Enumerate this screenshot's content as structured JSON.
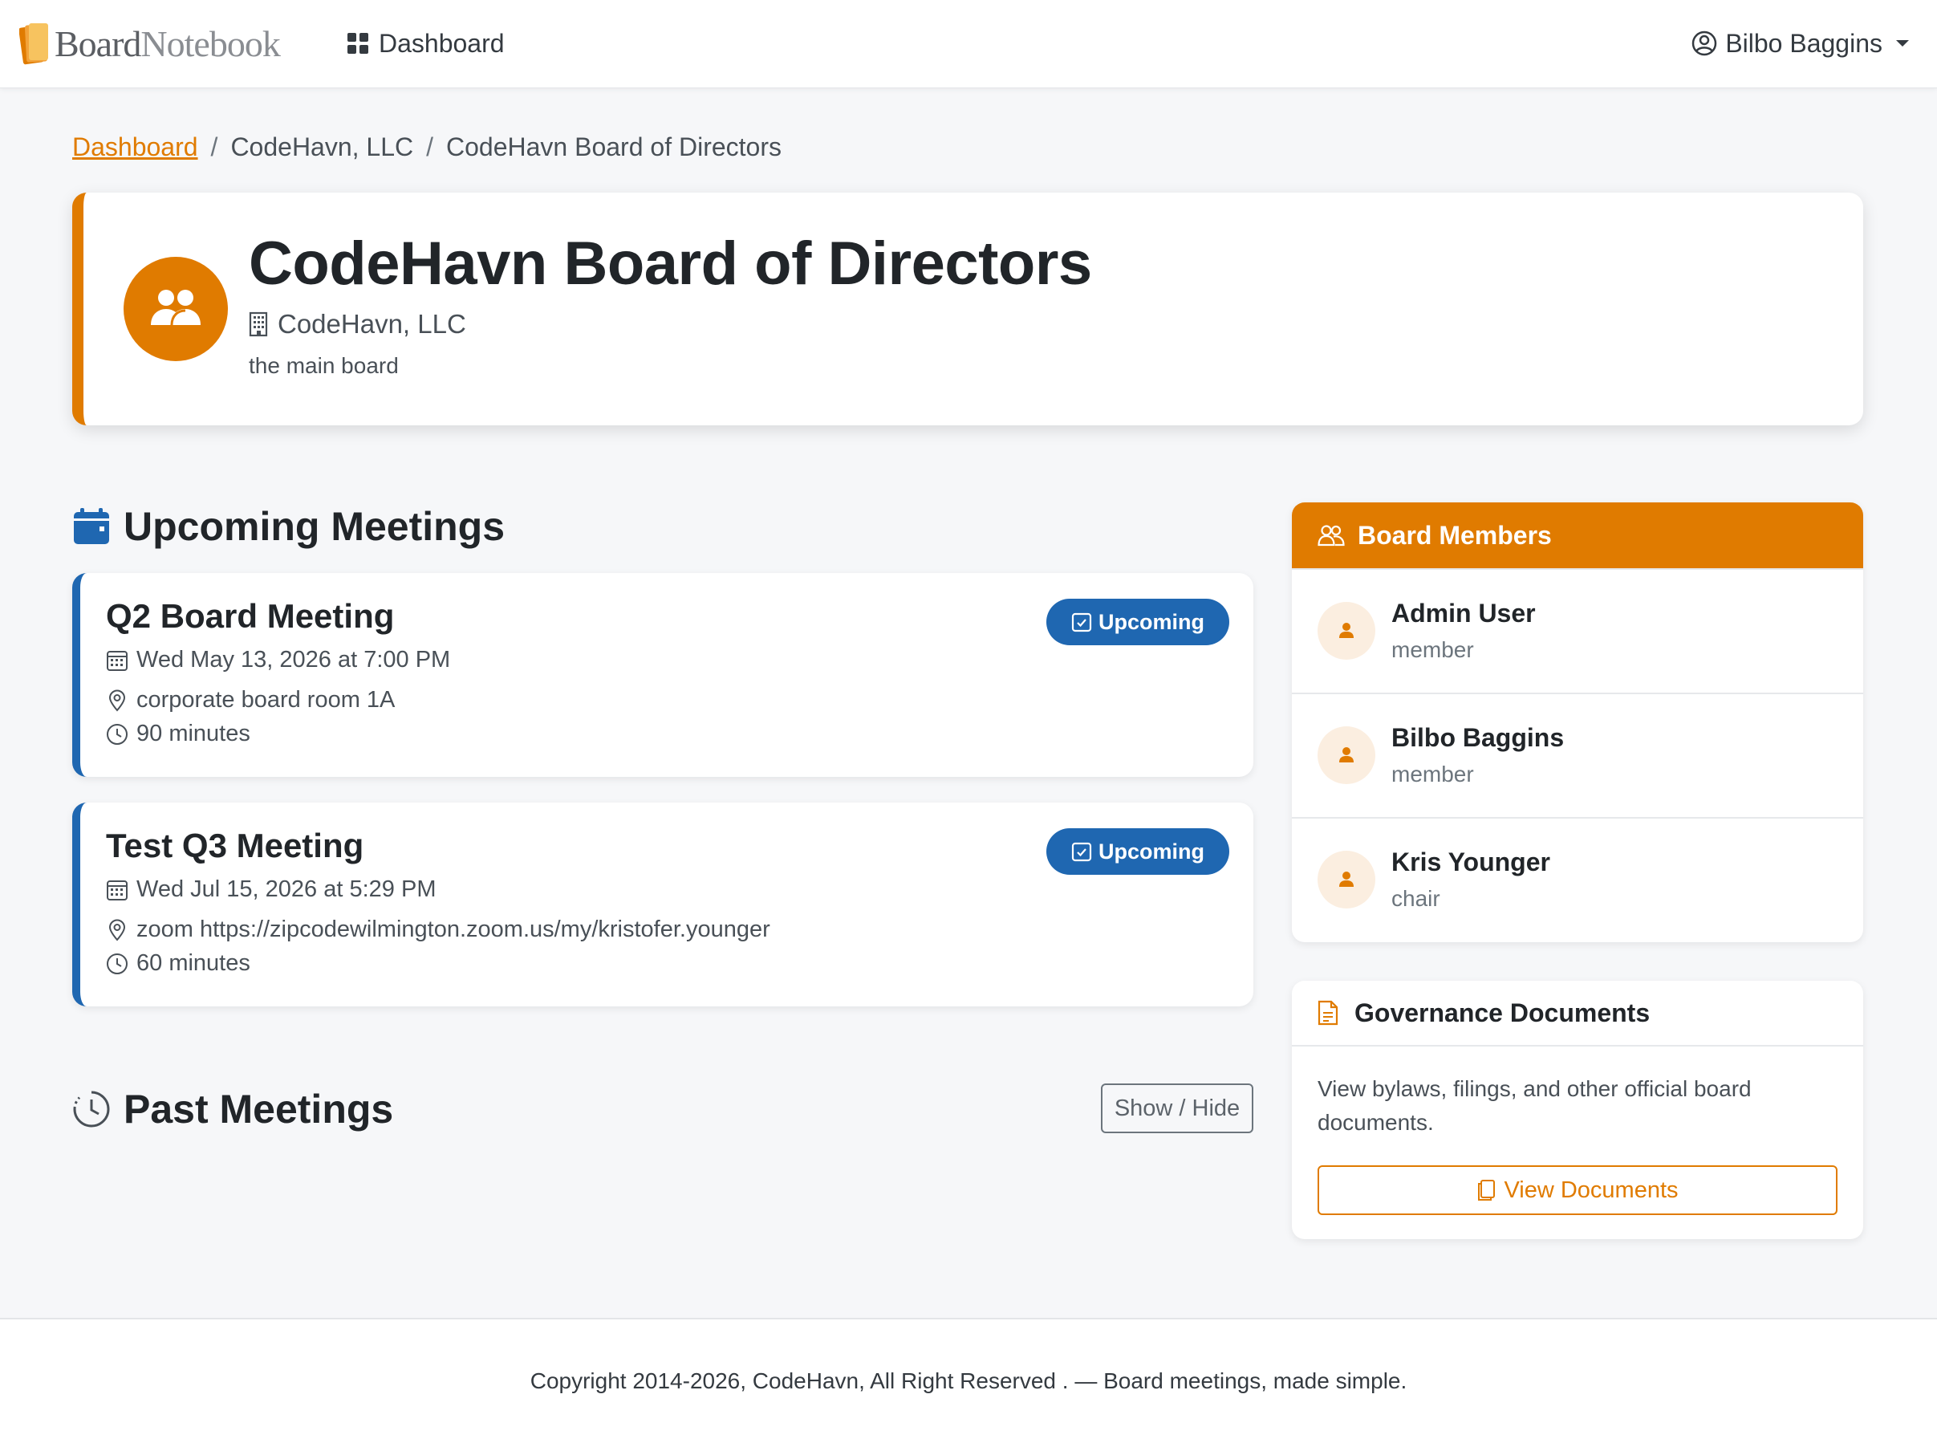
{
  "navbar": {
    "brand_part1": "Board",
    "brand_part2": "Notebook",
    "dashboard_label": "Dashboard",
    "user_name": "Bilbo Baggins"
  },
  "breadcrumb": {
    "items": [
      "Dashboard",
      "CodeHavn, LLC",
      "CodeHavn Board of Directors"
    ],
    "separator": "/"
  },
  "board": {
    "title": "CodeHavn Board of Directors",
    "organization": "CodeHavn, LLC",
    "description": "the main board"
  },
  "upcoming": {
    "heading": "Upcoming Meetings",
    "meetings": [
      {
        "title": "Q2 Board Meeting",
        "datetime": "Wed May 13, 2026 at 7:00 PM",
        "location": "corporate board room 1A",
        "duration": "90 minutes",
        "status": "Upcoming"
      },
      {
        "title": "Test Q3 Meeting",
        "datetime": "Wed Jul 15, 2026 at 5:29 PM",
        "location": "zoom https://zipcodewilmington.zoom.us/my/kristofer.younger",
        "duration": "60 minutes",
        "status": "Upcoming"
      }
    ]
  },
  "past": {
    "heading": "Past Meetings",
    "toggle_label": "Show / Hide"
  },
  "members": {
    "heading": "Board Members",
    "items": [
      {
        "name": "Admin User",
        "role": "member"
      },
      {
        "name": "Bilbo Baggins",
        "role": "member"
      },
      {
        "name": "Kris Younger",
        "role": "chair"
      }
    ]
  },
  "governance": {
    "heading": "Governance Documents",
    "text": "View bylaws, filings, and other official board documents.",
    "button_label": "View Documents"
  },
  "footer": {
    "text": "Copyright 2014-2026, CodeHavn, All Right Reserved . — Board meetings, made simple."
  },
  "colors": {
    "accent": "#e07b00",
    "primary": "#1f67b1",
    "background": "#f6f7f9"
  }
}
